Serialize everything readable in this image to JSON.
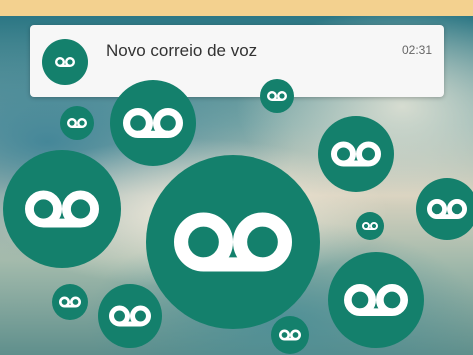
{
  "notification": {
    "title": "Novo correio de voz",
    "time": "02:31",
    "icon": "voicemail-icon"
  },
  "colors": {
    "top_band": "#f3d18f",
    "accent": "#14806c",
    "notification_bg": "#f7f7f7",
    "icon_stroke": "#ffffff"
  },
  "bubble_icon": "voicemail-icon"
}
